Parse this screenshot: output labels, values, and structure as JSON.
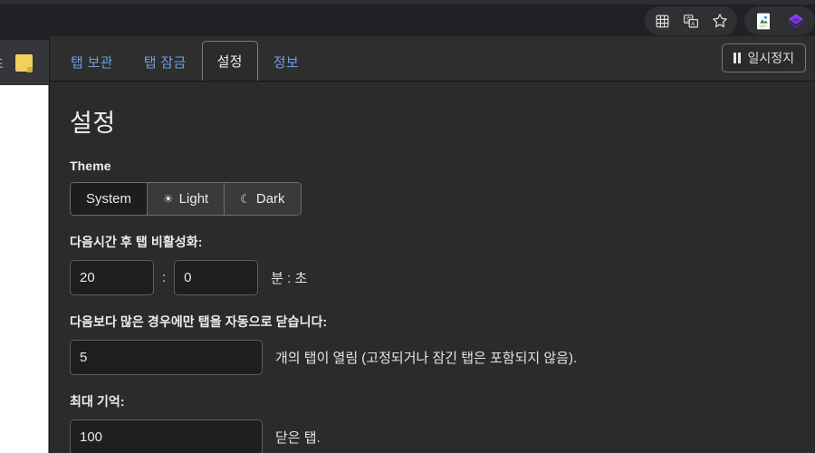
{
  "browser": {
    "toolbar_icons": [
      {
        "name": "grid-icon",
        "glyph": "grid"
      },
      {
        "name": "translate-icon",
        "glyph": "translate"
      },
      {
        "name": "bookmark-star-icon",
        "glyph": "star"
      }
    ],
    "extension_icons": [
      {
        "name": "document-extension-icon",
        "glyph": "doc"
      },
      {
        "name": "purple-cube-extension-icon",
        "glyph": "cube"
      }
    ],
    "bookmarks": {
      "truncated_label": "도",
      "folder_name": "bookmark-folder"
    }
  },
  "popup": {
    "tabs": [
      {
        "label": "탭 보관",
        "active": false
      },
      {
        "label": "탭 잠금",
        "active": false
      },
      {
        "label": "설정",
        "active": true
      },
      {
        "label": "정보",
        "active": false
      }
    ],
    "pause_button": {
      "label": "일시정지",
      "icon": "pause-icon"
    }
  },
  "settings": {
    "title": "설정",
    "theme": {
      "label": "Theme",
      "options": [
        {
          "label": "System",
          "icon": "",
          "selected": true
        },
        {
          "label": "Light",
          "icon": "☀",
          "selected": false
        },
        {
          "label": "Dark",
          "icon": "☾",
          "selected": false
        }
      ]
    },
    "discard_after": {
      "label": "다음시간 후 탭 비활성화:",
      "minutes": "20",
      "seconds": "0",
      "separator": ":",
      "suffix": "분 : 초"
    },
    "min_tabs": {
      "label": "다음보다 많은 경우에만 탭을 자동으로 닫습니다:",
      "value": "5",
      "suffix": "개의 탭이 열림 (고정되거나 잠긴 탭은 포함되지 않음)."
    },
    "max_history": {
      "label": "최대 기억:",
      "value": "100",
      "suffix": "닫은 탭."
    }
  },
  "colors": {
    "chrome_bg": "#202124",
    "popup_bg": "#2b2b2b",
    "tabstrip_bg": "#2e2e2e",
    "tab_link": "#6b9fe8",
    "input_bg": "#1e1e1e",
    "accent_folder": "#f3cf5e",
    "extension_cube": "#7b2fd6"
  }
}
